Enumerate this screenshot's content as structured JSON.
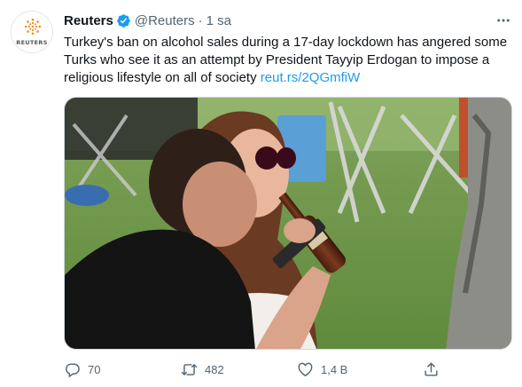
{
  "tweet": {
    "author_name": "Reuters",
    "handle": "@Reuters",
    "separator": "·",
    "time": "1 sa",
    "avatar_text": "REUTERS",
    "text": "Turkey's ban on alcohol sales during a 17-day lockdown has angered some Turks who see it as an attempt by President Tayyip Erdogan to impose a religious lifestyle on all of society",
    "link": "reut.rs/2QGmfiW"
  },
  "actions": {
    "reply_count": "70",
    "retweet_count": "482",
    "like_count": "1,4 B"
  },
  "icons": {
    "verified": "verified-badge-icon",
    "more": "more-horizontal-icon",
    "reply": "reply-icon",
    "retweet": "retweet-icon",
    "like": "heart-icon",
    "share": "share-icon"
  },
  "colors": {
    "text": "#0f1419",
    "secondary": "#536471",
    "link": "#1d9bf0",
    "verified": "#1d9bf0",
    "brand_orange": "#f08a24"
  }
}
